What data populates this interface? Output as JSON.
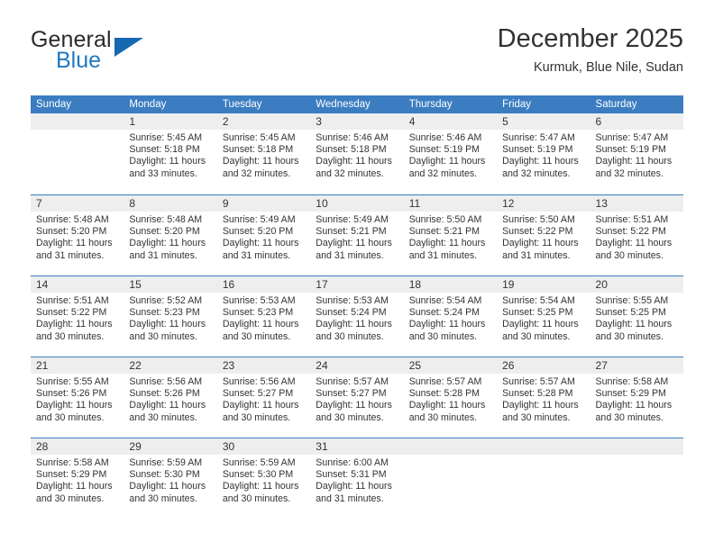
{
  "logo": {
    "word1": "General",
    "word2": "Blue",
    "triangle_color": "#1569b0",
    "blue_color": "#2179bf"
  },
  "header": {
    "month_title": "December 2025",
    "location": "Kurmuk, Blue Nile, Sudan"
  },
  "theme": {
    "header_blue": "#3b7dc0",
    "daynum_bg": "#eeeeee",
    "text": "#333333"
  },
  "weekdays": [
    "Sunday",
    "Monday",
    "Tuesday",
    "Wednesday",
    "Thursday",
    "Friday",
    "Saturday"
  ],
  "labels": {
    "sunrise_prefix": "Sunrise: ",
    "sunset_prefix": "Sunset: ",
    "daylight_prefix": "Daylight: "
  },
  "weeks": [
    [
      {
        "day": "",
        "empty": true
      },
      {
        "day": "1",
        "sunrise": "Sunrise: 5:45 AM",
        "sunset": "Sunset: 5:18 PM",
        "daylight": "Daylight: 11 hours and 33 minutes."
      },
      {
        "day": "2",
        "sunrise": "Sunrise: 5:45 AM",
        "sunset": "Sunset: 5:18 PM",
        "daylight": "Daylight: 11 hours and 32 minutes."
      },
      {
        "day": "3",
        "sunrise": "Sunrise: 5:46 AM",
        "sunset": "Sunset: 5:18 PM",
        "daylight": "Daylight: 11 hours and 32 minutes."
      },
      {
        "day": "4",
        "sunrise": "Sunrise: 5:46 AM",
        "sunset": "Sunset: 5:19 PM",
        "daylight": "Daylight: 11 hours and 32 minutes."
      },
      {
        "day": "5",
        "sunrise": "Sunrise: 5:47 AM",
        "sunset": "Sunset: 5:19 PM",
        "daylight": "Daylight: 11 hours and 32 minutes."
      },
      {
        "day": "6",
        "sunrise": "Sunrise: 5:47 AM",
        "sunset": "Sunset: 5:19 PM",
        "daylight": "Daylight: 11 hours and 32 minutes."
      }
    ],
    [
      {
        "day": "7",
        "sunrise": "Sunrise: 5:48 AM",
        "sunset": "Sunset: 5:20 PM",
        "daylight": "Daylight: 11 hours and 31 minutes."
      },
      {
        "day": "8",
        "sunrise": "Sunrise: 5:48 AM",
        "sunset": "Sunset: 5:20 PM",
        "daylight": "Daylight: 11 hours and 31 minutes."
      },
      {
        "day": "9",
        "sunrise": "Sunrise: 5:49 AM",
        "sunset": "Sunset: 5:20 PM",
        "daylight": "Daylight: 11 hours and 31 minutes."
      },
      {
        "day": "10",
        "sunrise": "Sunrise: 5:49 AM",
        "sunset": "Sunset: 5:21 PM",
        "daylight": "Daylight: 11 hours and 31 minutes."
      },
      {
        "day": "11",
        "sunrise": "Sunrise: 5:50 AM",
        "sunset": "Sunset: 5:21 PM",
        "daylight": "Daylight: 11 hours and 31 minutes."
      },
      {
        "day": "12",
        "sunrise": "Sunrise: 5:50 AM",
        "sunset": "Sunset: 5:22 PM",
        "daylight": "Daylight: 11 hours and 31 minutes."
      },
      {
        "day": "13",
        "sunrise": "Sunrise: 5:51 AM",
        "sunset": "Sunset: 5:22 PM",
        "daylight": "Daylight: 11 hours and 30 minutes."
      }
    ],
    [
      {
        "day": "14",
        "sunrise": "Sunrise: 5:51 AM",
        "sunset": "Sunset: 5:22 PM",
        "daylight": "Daylight: 11 hours and 30 minutes."
      },
      {
        "day": "15",
        "sunrise": "Sunrise: 5:52 AM",
        "sunset": "Sunset: 5:23 PM",
        "daylight": "Daylight: 11 hours and 30 minutes."
      },
      {
        "day": "16",
        "sunrise": "Sunrise: 5:53 AM",
        "sunset": "Sunset: 5:23 PM",
        "daylight": "Daylight: 11 hours and 30 minutes."
      },
      {
        "day": "17",
        "sunrise": "Sunrise: 5:53 AM",
        "sunset": "Sunset: 5:24 PM",
        "daylight": "Daylight: 11 hours and 30 minutes."
      },
      {
        "day": "18",
        "sunrise": "Sunrise: 5:54 AM",
        "sunset": "Sunset: 5:24 PM",
        "daylight": "Daylight: 11 hours and 30 minutes."
      },
      {
        "day": "19",
        "sunrise": "Sunrise: 5:54 AM",
        "sunset": "Sunset: 5:25 PM",
        "daylight": "Daylight: 11 hours and 30 minutes."
      },
      {
        "day": "20",
        "sunrise": "Sunrise: 5:55 AM",
        "sunset": "Sunset: 5:25 PM",
        "daylight": "Daylight: 11 hours and 30 minutes."
      }
    ],
    [
      {
        "day": "21",
        "sunrise": "Sunrise: 5:55 AM",
        "sunset": "Sunset: 5:26 PM",
        "daylight": "Daylight: 11 hours and 30 minutes."
      },
      {
        "day": "22",
        "sunrise": "Sunrise: 5:56 AM",
        "sunset": "Sunset: 5:26 PM",
        "daylight": "Daylight: 11 hours and 30 minutes."
      },
      {
        "day": "23",
        "sunrise": "Sunrise: 5:56 AM",
        "sunset": "Sunset: 5:27 PM",
        "daylight": "Daylight: 11 hours and 30 minutes."
      },
      {
        "day": "24",
        "sunrise": "Sunrise: 5:57 AM",
        "sunset": "Sunset: 5:27 PM",
        "daylight": "Daylight: 11 hours and 30 minutes."
      },
      {
        "day": "25",
        "sunrise": "Sunrise: 5:57 AM",
        "sunset": "Sunset: 5:28 PM",
        "daylight": "Daylight: 11 hours and 30 minutes."
      },
      {
        "day": "26",
        "sunrise": "Sunrise: 5:57 AM",
        "sunset": "Sunset: 5:28 PM",
        "daylight": "Daylight: 11 hours and 30 minutes."
      },
      {
        "day": "27",
        "sunrise": "Sunrise: 5:58 AM",
        "sunset": "Sunset: 5:29 PM",
        "daylight": "Daylight: 11 hours and 30 minutes."
      }
    ],
    [
      {
        "day": "28",
        "sunrise": "Sunrise: 5:58 AM",
        "sunset": "Sunset: 5:29 PM",
        "daylight": "Daylight: 11 hours and 30 minutes."
      },
      {
        "day": "29",
        "sunrise": "Sunrise: 5:59 AM",
        "sunset": "Sunset: 5:30 PM",
        "daylight": "Daylight: 11 hours and 30 minutes."
      },
      {
        "day": "30",
        "sunrise": "Sunrise: 5:59 AM",
        "sunset": "Sunset: 5:30 PM",
        "daylight": "Daylight: 11 hours and 30 minutes."
      },
      {
        "day": "31",
        "sunrise": "Sunrise: 6:00 AM",
        "sunset": "Sunset: 5:31 PM",
        "daylight": "Daylight: 11 hours and 31 minutes."
      },
      {
        "day": "",
        "empty": true
      },
      {
        "day": "",
        "empty": true
      },
      {
        "day": "",
        "empty": true
      }
    ]
  ]
}
